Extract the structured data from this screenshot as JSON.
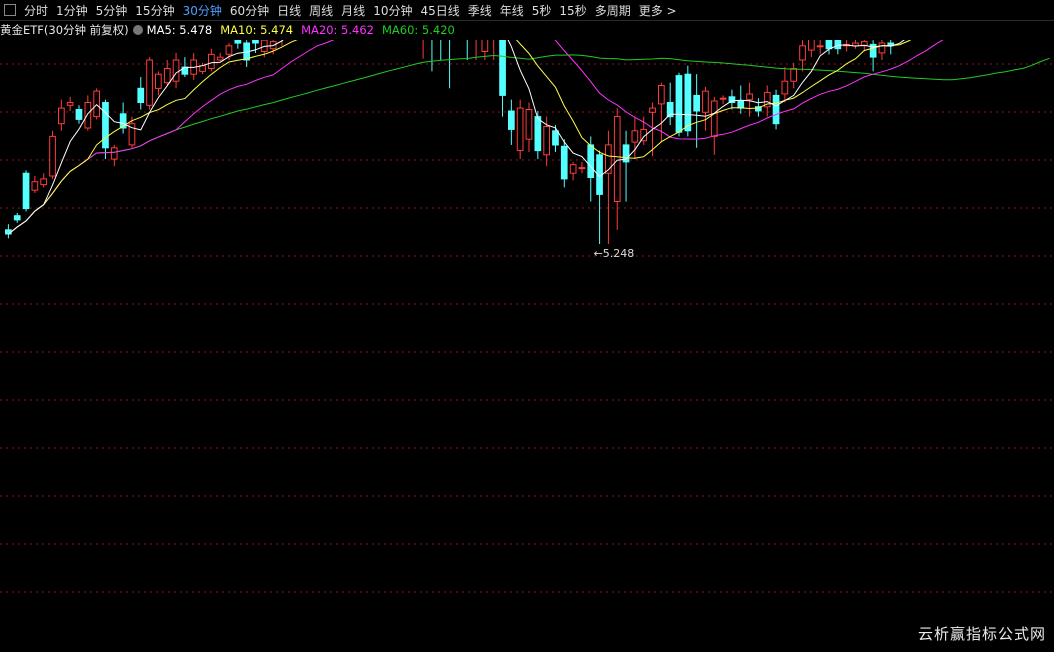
{
  "toolbar": {
    "periods": [
      "分时",
      "1分钟",
      "5分钟",
      "15分钟",
      "30分钟",
      "60分钟",
      "日线",
      "周线",
      "月线",
      "10分钟",
      "45日线",
      "季线",
      "年线",
      "5秒",
      "15秒",
      "多周期"
    ],
    "active_period": "30分钟",
    "more_label": "更多 >"
  },
  "legend": {
    "title": "黄金ETF(30分钟 前复权)",
    "ma5": "MA5: 5.478",
    "ma10": "MA10: 5.474",
    "ma20": "MA20: 5.462",
    "ma60": "MA60: 5.420"
  },
  "colors": {
    "up": "#ff3b3b",
    "down": "#54ffff",
    "ma5": "#ffffff",
    "ma10": "#ffff44",
    "ma20": "#ff33ff",
    "ma60": "#22cc22",
    "active": "#4fa0ff",
    "grid": "#8a1a1a"
  },
  "chart_data": {
    "type": "candlestick",
    "y_range": [
      5.23,
      5.62
    ],
    "low_marker_label": "←5.248",
    "candles": [
      [
        5.5,
        5.497,
        5.504,
        5.494
      ],
      [
        5.51,
        5.507,
        5.512,
        5.505
      ],
      [
        5.54,
        5.515,
        5.542,
        5.513
      ],
      [
        5.528,
        5.534,
        5.538,
        5.526
      ],
      [
        5.532,
        5.536,
        5.54,
        5.53
      ],
      [
        5.538,
        5.566,
        5.57,
        5.536
      ],
      [
        5.575,
        5.586,
        5.592,
        5.57
      ],
      [
        5.588,
        5.59,
        5.594,
        5.584
      ],
      [
        5.585,
        5.578,
        5.588,
        5.575
      ],
      [
        5.572,
        5.59,
        5.595,
        5.57
      ],
      [
        5.58,
        5.598,
        5.6,
        5.578
      ],
      [
        5.59,
        5.558,
        5.592,
        5.55
      ],
      [
        5.55,
        5.558,
        5.56,
        5.545
      ],
      [
        5.582,
        5.572,
        5.59,
        5.568
      ],
      [
        5.56,
        5.575,
        5.58,
        5.558
      ],
      [
        5.6,
        5.59,
        5.608,
        5.585
      ],
      [
        5.588,
        5.62,
        5.622,
        5.585
      ],
      [
        5.6,
        5.61,
        5.612,
        5.595
      ],
      [
        5.604,
        5.614,
        5.62,
        5.602
      ],
      [
        5.605,
        5.62,
        5.625,
        5.6
      ],
      [
        5.615,
        5.61,
        5.622,
        5.608
      ],
      [
        5.61,
        5.62,
        5.625,
        5.606
      ],
      [
        5.612,
        5.616,
        5.618,
        5.61
      ],
      [
        5.614,
        5.624,
        5.628,
        5.612
      ],
      [
        5.62,
        5.622,
        5.625,
        5.619
      ],
      [
        5.624,
        5.63,
        5.632,
        5.62
      ],
      [
        5.636,
        5.632,
        5.642,
        5.628
      ],
      [
        5.632,
        5.62,
        5.634,
        5.615
      ],
      [
        5.638,
        5.632,
        5.64,
        5.625
      ],
      [
        5.626,
        5.634,
        5.646,
        5.622
      ],
      [
        5.628,
        5.633,
        5.64,
        5.624
      ],
      [
        5.64,
        5.648,
        5.652,
        5.63
      ],
      [
        5.642,
        5.65,
        5.655,
        5.638
      ],
      [
        5.648,
        5.65,
        5.656,
        5.64
      ],
      [
        5.648,
        5.652,
        5.658,
        5.644
      ],
      [
        5.652,
        5.664,
        5.668,
        5.648
      ],
      [
        5.662,
        5.66,
        5.668,
        5.656
      ],
      [
        5.66,
        5.662,
        5.666,
        5.652
      ],
      [
        5.664,
        5.668,
        5.672,
        5.66
      ],
      [
        5.666,
        5.668,
        5.672,
        5.66
      ],
      [
        5.668,
        5.674,
        5.68,
        5.66
      ],
      [
        5.676,
        5.68,
        5.684,
        5.672
      ],
      [
        5.674,
        5.683,
        5.686,
        5.67
      ],
      [
        5.68,
        5.685,
        5.69,
        5.676
      ],
      [
        5.682,
        5.683,
        5.688,
        5.678
      ],
      [
        5.684,
        5.687,
        5.69,
        5.676
      ],
      [
        5.656,
        5.694,
        5.7,
        5.652
      ],
      [
        5.643,
        5.687,
        5.703,
        5.621
      ],
      [
        5.664,
        5.656,
        5.668,
        5.612
      ],
      [
        5.67,
        5.652,
        5.674,
        5.62
      ],
      [
        5.66,
        5.644,
        5.662,
        5.6
      ],
      [
        5.651,
        5.648,
        5.656,
        5.644
      ],
      [
        5.65,
        5.636,
        5.68,
        5.62
      ],
      [
        5.648,
        5.669,
        5.674,
        5.62
      ],
      [
        5.626,
        5.651,
        5.66,
        5.62
      ],
      [
        5.637,
        5.661,
        5.664,
        5.62
      ],
      [
        5.655,
        5.595,
        5.668,
        5.58
      ],
      [
        5.584,
        5.571,
        5.592,
        5.56
      ],
      [
        5.556,
        5.586,
        5.592,
        5.55
      ],
      [
        5.564,
        5.585,
        5.59,
        5.555
      ],
      [
        5.58,
        5.556,
        5.584,
        5.55
      ],
      [
        5.553,
        5.573,
        5.58,
        5.545
      ],
      [
        5.57,
        5.56,
        5.574,
        5.555
      ],
      [
        5.559,
        5.536,
        5.564,
        5.53
      ],
      [
        5.54,
        5.546,
        5.548,
        5.535
      ],
      [
        5.544,
        5.544,
        5.548,
        5.54
      ],
      [
        5.56,
        5.537,
        5.566,
        5.52
      ],
      [
        5.553,
        5.525,
        5.556,
        5.49
      ],
      [
        5.54,
        5.56,
        5.57,
        5.49
      ],
      [
        5.52,
        5.58,
        5.586,
        5.5
      ],
      [
        5.56,
        5.548,
        5.57,
        5.52
      ],
      [
        5.562,
        5.57,
        5.58,
        5.55
      ],
      [
        5.563,
        5.571,
        5.58,
        5.56
      ],
      [
        5.583,
        5.586,
        5.59,
        5.552
      ],
      [
        5.589,
        5.602,
        5.604,
        5.562
      ],
      [
        5.59,
        5.58,
        5.604,
        5.574
      ],
      [
        5.609,
        5.569,
        5.611,
        5.566
      ],
      [
        5.61,
        5.57,
        5.616,
        5.566
      ],
      [
        5.595,
        5.584,
        5.61,
        5.558
      ],
      [
        5.583,
        5.598,
        5.601,
        5.57
      ],
      [
        5.566,
        5.591,
        5.594,
        5.553
      ],
      [
        5.593,
        5.593,
        5.595,
        5.589
      ],
      [
        5.594,
        5.59,
        5.599,
        5.585
      ],
      [
        5.591,
        5.586,
        5.602,
        5.582
      ],
      [
        5.592,
        5.596,
        5.604,
        5.58
      ],
      [
        5.587,
        5.584,
        5.593,
        5.58
      ],
      [
        5.587,
        5.597,
        5.602,
        5.58
      ],
      [
        5.595,
        5.575,
        5.599,
        5.571
      ],
      [
        5.596,
        5.605,
        5.615,
        5.59
      ],
      [
        5.605,
        5.614,
        5.618,
        5.6
      ],
      [
        5.62,
        5.63,
        5.634,
        5.612
      ],
      [
        5.627,
        5.636,
        5.64,
        5.622
      ],
      [
        5.63,
        5.63,
        5.638,
        5.624
      ],
      [
        5.638,
        5.628,
        5.64,
        5.624
      ],
      [
        5.634,
        5.628,
        5.642,
        5.624
      ],
      [
        5.63,
        5.631,
        5.64,
        5.626
      ],
      [
        5.63,
        5.632,
        5.64,
        5.628
      ],
      [
        5.63,
        5.633,
        5.64,
        5.626
      ],
      [
        5.631,
        5.622,
        5.634,
        5.612
      ],
      [
        5.625,
        5.632,
        5.636,
        5.62
      ],
      [
        5.632,
        5.63,
        5.636,
        5.624
      ],
      [
        5.64,
        5.642,
        5.648,
        5.636
      ],
      [
        5.65,
        5.656,
        5.66,
        5.646
      ],
      [
        5.66,
        5.662,
        5.668,
        5.656
      ],
      [
        5.664,
        5.665,
        5.67,
        5.66
      ],
      [
        5.664,
        5.668,
        5.674,
        5.66
      ],
      [
        5.668,
        5.674,
        5.678,
        5.664
      ],
      [
        5.68,
        5.68,
        5.686,
        5.674
      ],
      [
        5.69,
        5.7,
        5.705,
        5.686
      ],
      [
        5.708,
        5.7,
        5.716,
        5.704
      ],
      [
        5.708,
        5.7,
        5.712,
        5.702
      ],
      [
        5.706,
        5.712,
        5.718,
        5.702
      ],
      [
        5.71,
        5.716,
        5.722,
        5.706
      ],
      [
        5.73,
        5.724,
        5.734,
        5.72
      ],
      [
        5.72,
        5.724,
        5.736,
        5.716
      ],
      [
        5.722,
        5.728,
        5.73,
        5.716
      ],
      [
        5.724,
        5.725,
        5.728,
        5.716
      ],
      [
        5.714,
        5.731,
        5.734,
        5.71
      ],
      [
        5.712,
        5.721,
        5.724,
        5.708
      ]
    ]
  }
}
